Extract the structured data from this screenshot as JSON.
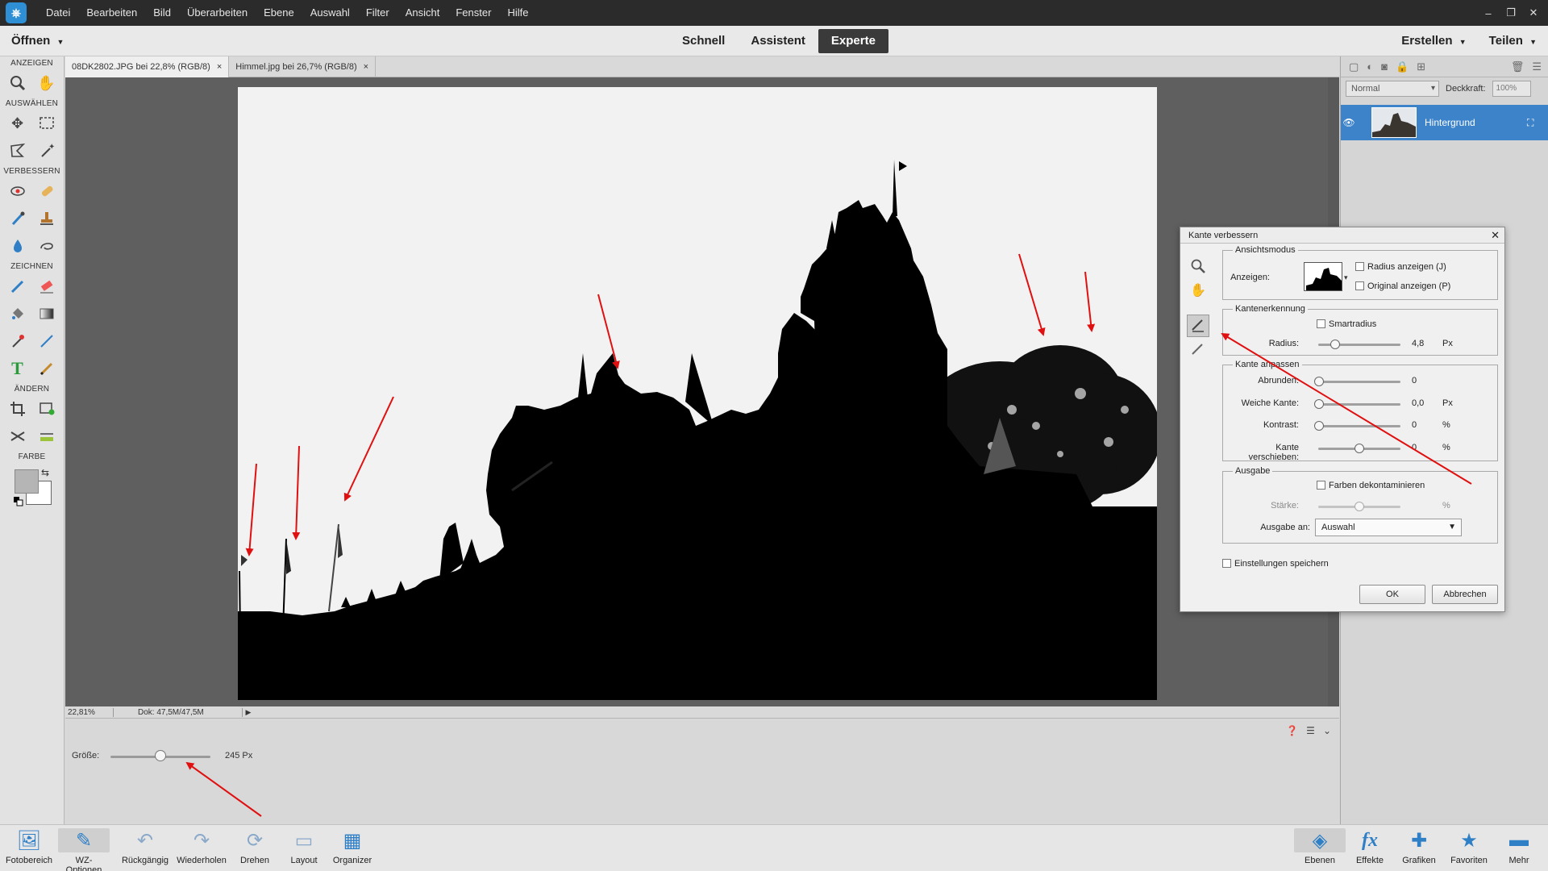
{
  "menubar": {
    "items": [
      "Datei",
      "Bearbeiten",
      "Bild",
      "Überarbeiten",
      "Ebene",
      "Auswahl",
      "Filter",
      "Ansicht",
      "Fenster",
      "Hilfe"
    ],
    "controls": [
      "‒",
      "❐",
      "✕"
    ]
  },
  "actionbar": {
    "open_label": "Öffnen",
    "modes": [
      "Schnell",
      "Assistent",
      "Experte"
    ],
    "active_mode": "Experte",
    "create_label": "Erstellen",
    "share_label": "Teilen"
  },
  "toolbox": {
    "sections": {
      "view": "ANZEIGEN",
      "select": "AUSWÄHLEN",
      "enhance": "VERBESSERN",
      "draw": "ZEICHNEN",
      "modify": "ÄNDERN",
      "color": "FARBE"
    }
  },
  "documents": {
    "tabs": [
      {
        "label": "08DK2802.JPG bei 22,8% (RGB/8)",
        "active": true
      },
      {
        "label": "Himmel.jpg bei 26,7% (RGB/8)",
        "active": false
      }
    ],
    "zoom": "22,81%",
    "doc_info": "Dok: 47,5M/47,5M"
  },
  "tool_options": {
    "size_label": "Größe:",
    "size_value": "245 Px",
    "size_fraction": 0.5
  },
  "layers": {
    "blend_mode": "Normal",
    "opacity_label": "Deckkraft:",
    "opacity_value": "100%",
    "layer_name": "Hintergrund"
  },
  "bottombar": {
    "left": [
      "Fotobereich",
      "WZ-Optionen",
      "Rückgängig",
      "Wiederholen",
      "Drehen",
      "Layout",
      "Organizer"
    ],
    "right": [
      "Ebenen",
      "Effekte",
      "Grafiken",
      "Favoriten",
      "Mehr"
    ]
  },
  "dialog": {
    "title": "Kante verbessern",
    "view_mode": {
      "legend": "Ansichtsmodus",
      "show_label": "Anzeigen:",
      "show_radius": "Radius anzeigen (J)",
      "show_original": "Original anzeigen (P)"
    },
    "edge_detection": {
      "legend": "Kantenerkennung",
      "smart_radius": "Smartradius",
      "radius_label": "Radius:",
      "radius_value": "4,8",
      "radius_unit": "Px"
    },
    "adjust_edge": {
      "legend": "Kante anpassen",
      "smooth_label": "Abrunden:",
      "smooth_value": "0",
      "feather_label": "Weiche Kante:",
      "feather_value": "0,0",
      "feather_unit": "Px",
      "contrast_label": "Kontrast:",
      "contrast_value": "0",
      "contrast_unit": "%",
      "shift_label": "Kante verschieben:",
      "shift_value": "0",
      "shift_unit": "%"
    },
    "output": {
      "legend": "Ausgabe",
      "decontaminate": "Farben dekontaminieren",
      "amount_label": "Stärke:",
      "amount_unit": "%",
      "output_to_label": "Ausgabe an:",
      "output_to_value": "Auswahl"
    },
    "remember": "Einstellungen speichern",
    "ok": "OK",
    "cancel": "Abbrechen"
  },
  "colors": {
    "menubar_bg": "#2b2b2b",
    "accent_blue": "#3d83c9",
    "annotation_red": "#e01010",
    "canvas_bg": "#5f5f5f"
  }
}
